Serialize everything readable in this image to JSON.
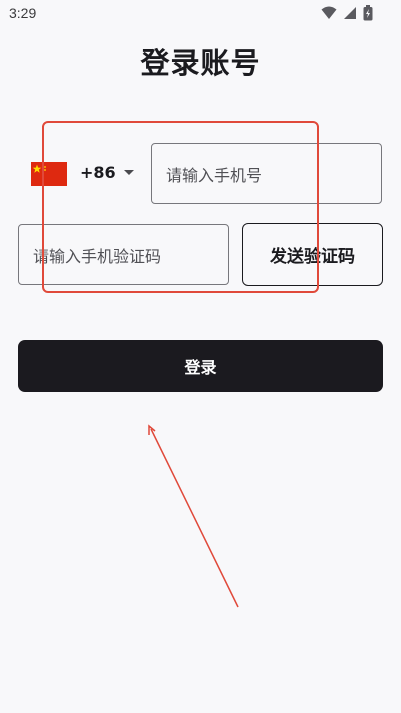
{
  "status_bar": {
    "time": "3:29",
    "icons": [
      "wifi-icon",
      "signal-icon",
      "battery-icon"
    ]
  },
  "page": {
    "title": "登录账号"
  },
  "phone": {
    "country_flag": "china-flag-icon",
    "country_code": "+86",
    "placeholder": "请输入手机号"
  },
  "verification": {
    "placeholder": "请输入手机验证码",
    "send_code_label": "发送验证码"
  },
  "login": {
    "label": "登录"
  },
  "colors": {
    "background": "#f8f8fa",
    "primary": "#1b1a1f",
    "annotation": "#e0493a",
    "flag_red": "#de2910",
    "flag_yellow": "#ffde00"
  }
}
